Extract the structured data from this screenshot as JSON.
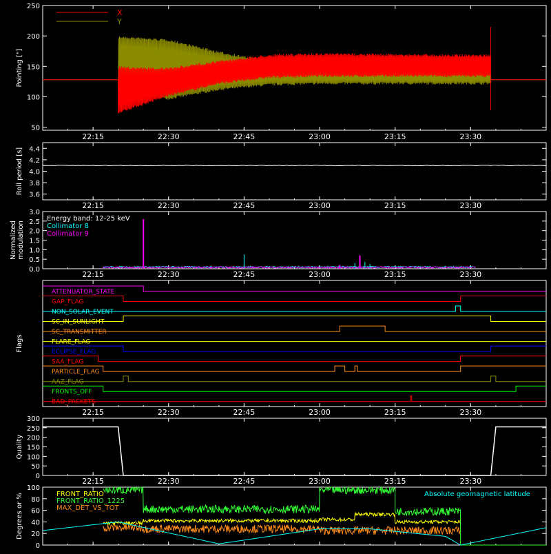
{
  "time_ticks": [
    "22:15",
    "22:30",
    "22:45",
    "23:00",
    "23:15",
    "23:30"
  ],
  "time_range": [
    "22:05",
    "23:45"
  ],
  "colors": {
    "background": "#000000",
    "axes": "#ffffff",
    "red": "#ff0000",
    "olive": "#8b8b00",
    "cyan": "#00ffff",
    "magenta": "#ff00ff",
    "yellow": "#ffff00",
    "orange": "#ff8c1a",
    "green": "#00ff00",
    "blue": "#0000ff",
    "bright_green": "#33ff33"
  },
  "chart_data": [
    {
      "type": "line",
      "ylabel": "Pointing [\"]",
      "ylim": [
        45,
        250
      ],
      "yticks": [
        50,
        100,
        150,
        200,
        250
      ],
      "legend": [
        {
          "name": "X",
          "color": "#ff0000"
        },
        {
          "name": "Y",
          "color": "#8b8b00"
        }
      ],
      "series": [
        {
          "name": "X",
          "flat_value": 128,
          "oscillation_start": "22:20",
          "oscillation_end": "23:34",
          "envelope_low": [
            [
              "22:20",
              72
            ],
            [
              "22:30",
              100
            ],
            [
              "22:40",
              120
            ],
            [
              "22:50",
              130
            ],
            [
              "23:00",
              132
            ],
            [
              "23:30",
              132
            ]
          ],
          "envelope_high": [
            [
              "22:20",
              150
            ],
            [
              "22:30",
              148
            ],
            [
              "22:40",
              160
            ],
            [
              "22:50",
              170
            ],
            [
              "23:00",
              172
            ],
            [
              "23:30",
              170
            ]
          ]
        },
        {
          "name": "Y",
          "flat_value": 128,
          "oscillation_start": "22:20",
          "oscillation_end": "23:34",
          "envelope_low": [
            [
              "22:20",
              110
            ],
            [
              "22:30",
              95
            ],
            [
              "22:40",
              110
            ],
            [
              "22:50",
              118
            ],
            [
              "23:00",
              120
            ],
            [
              "23:30",
              120
            ]
          ],
          "envelope_high": [
            [
              "22:20",
              200
            ],
            [
              "22:30",
              195
            ],
            [
              "22:40",
              175
            ],
            [
              "22:50",
              160
            ],
            [
              "23:00",
              158
            ],
            [
              "23:30",
              155
            ]
          ]
        }
      ]
    },
    {
      "type": "line",
      "ylabel": "Roll period [s]",
      "ylim": [
        3.5,
        4.5
      ],
      "yticks": [
        3.6,
        3.8,
        4.0,
        4.2,
        4.4
      ],
      "series": [
        {
          "name": "",
          "constant": 4.1
        }
      ]
    },
    {
      "type": "line",
      "ylabel_lines": [
        "Normalized",
        "modulation"
      ],
      "ylim": [
        0,
        3.0
      ],
      "yticks": [
        0.0,
        0.5,
        1.0,
        1.5,
        2.0,
        2.5,
        3.0
      ],
      "annotations": [
        {
          "text": "Energy band: 12-25 keV",
          "color": "#ffffff"
        },
        {
          "text": "Collimator 8",
          "color": "#00ffff"
        },
        {
          "text": "Collimator 9",
          "color": "#ff00ff"
        }
      ],
      "series": [
        {
          "name": "Collimator 8",
          "baseline": 0.05,
          "range": [
            "22:17",
            "23:31"
          ],
          "spikes": [
            [
              "22:45",
              0.75
            ],
            [
              "23:07",
              0.3
            ],
            [
              "23:09",
              0.35
            ],
            [
              "23:10",
              0.25
            ]
          ]
        },
        {
          "name": "Collimator 9",
          "baseline": 0.03,
          "range": [
            "22:17",
            "23:31"
          ],
          "spikes": [
            [
              "22:25",
              2.6
            ],
            [
              "23:08",
              0.7
            ],
            [
              "23:04",
              0.2
            ]
          ]
        }
      ]
    },
    {
      "type": "step",
      "ylabel": "Flags",
      "flags": [
        {
          "name": "ATTENUATOR_STATE",
          "color": "#ff00ff",
          "steps": [
            [
              "22:05",
              1
            ],
            [
              "22:25",
              0
            ],
            [
              "23:45",
              0
            ]
          ]
        },
        {
          "name": "GAP_FLAG",
          "color": "#ff0000",
          "steps": [
            [
              "22:05",
              1
            ],
            [
              "22:21",
              0
            ],
            [
              "23:28",
              1
            ],
            [
              "23:45",
              1
            ]
          ]
        },
        {
          "name": "NON_SOLAR_EVENT",
          "color": "#00ffff",
          "steps": [
            [
              "22:05",
              0
            ],
            [
              "23:27",
              1
            ],
            [
              "23:28",
              0
            ],
            [
              "23:45",
              0
            ]
          ]
        },
        {
          "name": "SC_IN_SUNLIGHT",
          "color": "#ffff00",
          "steps": [
            [
              "22:05",
              0
            ],
            [
              "22:21",
              1
            ],
            [
              "23:34",
              0
            ],
            [
              "23:45",
              0
            ]
          ]
        },
        {
          "name": "SC_TRANSMITTER",
          "color": "#ff8c1a",
          "steps": [
            [
              "22:05",
              0
            ],
            [
              "23:04",
              1
            ],
            [
              "23:13",
              0
            ],
            [
              "23:45",
              0
            ]
          ]
        },
        {
          "name": "FLARE_FLAG",
          "color": "#ffff00",
          "steps": [
            [
              "22:05",
              0
            ],
            [
              "23:45",
              0
            ]
          ]
        },
        {
          "name": "ECLIPSE_FLAG",
          "color": "#0000ff",
          "steps": [
            [
              "22:05",
              1
            ],
            [
              "22:21",
              0
            ],
            [
              "23:34",
              1
            ],
            [
              "23:45",
              1
            ]
          ]
        },
        {
          "name": "SAA_FLAG",
          "color": "#ff0000",
          "steps": [
            [
              "22:05",
              1
            ],
            [
              "22:16",
              0
            ],
            [
              "23:28",
              1
            ],
            [
              "23:45",
              1
            ]
          ]
        },
        {
          "name": "PARTICLE_FLAG",
          "color": "#ff8c1a",
          "steps": [
            [
              "22:05",
              1
            ],
            [
              "22:17",
              0
            ],
            [
              "23:03",
              1
            ],
            [
              "23:05",
              0
            ],
            [
              "23:07",
              1
            ],
            [
              "23:07.5",
              0
            ],
            [
              "23:28",
              1
            ],
            [
              "23:45",
              1
            ]
          ]
        },
        {
          "name": "AAZ_FLAG",
          "color": "#8b8b00",
          "steps": [
            [
              "22:05",
              0
            ],
            [
              "22:21",
              1
            ],
            [
              "22:22",
              0
            ],
            [
              "23:34",
              1
            ],
            [
              "23:35",
              0
            ],
            [
              "23:45",
              0
            ]
          ]
        },
        {
          "name": "FRONTS_OFF",
          "color": "#00ff00",
          "steps": [
            [
              "22:05",
              1
            ],
            [
              "22:17",
              0
            ],
            [
              "23:39",
              1
            ],
            [
              "23:45",
              1
            ]
          ]
        },
        {
          "name": "BAD_PACKETS",
          "color": "#ff0000",
          "steps": [
            [
              "22:05",
              0
            ],
            [
              "23:18",
              1
            ],
            [
              "23:18.3",
              0
            ],
            [
              "23:45",
              0
            ]
          ]
        }
      ]
    },
    {
      "type": "line",
      "ylabel": "Quality",
      "ylim": [
        0,
        300
      ],
      "yticks": [
        0,
        50,
        100,
        150,
        200,
        250,
        300
      ],
      "series": [
        {
          "name": "",
          "steps": [
            [
              "22:05",
              255
            ],
            [
              "22:20",
              255
            ],
            [
              "22:21",
              0
            ],
            [
              "23:34",
              0
            ],
            [
              "23:35",
              255
            ],
            [
              "23:45",
              255
            ]
          ]
        }
      ]
    },
    {
      "type": "line",
      "ylabel": "Degrees or %",
      "ylim": [
        0,
        100
      ],
      "yticks": [
        0,
        20,
        40,
        60,
        80,
        100
      ],
      "legend": [
        {
          "name": "FRONT_RATIO",
          "color": "#ffff00"
        },
        {
          "name": "FRONT_RATIO_1225",
          "color": "#33ff33"
        },
        {
          "name": "MAX_DET_VS_TOT",
          "color": "#ff8c1a"
        },
        {
          "name": "Absolute geomagnetic latitude",
          "color": "#00ffff"
        }
      ],
      "series": [
        {
          "name": "Absolute geomagnetic latitude",
          "points": [
            [
              "22:05",
              25
            ],
            [
              "22:20",
              40
            ],
            [
              "22:40",
              2
            ],
            [
              "23:00",
              28
            ],
            [
              "23:10",
              28
            ],
            [
              "23:25",
              15
            ],
            [
              "23:28",
              0
            ],
            [
              "23:45",
              30
            ]
          ]
        },
        {
          "name": "FRONT_RATIO_1225",
          "segments": [
            [
              "22:17",
              "22:25",
              95
            ],
            [
              "22:25",
              "23:00",
              62
            ],
            [
              "23:00",
              "23:15",
              95
            ],
            [
              "23:15",
              "23:28",
              58
            ],
            [
              "23:28",
              "23:45",
              0
            ]
          ]
        },
        {
          "name": "FRONT_RATIO",
          "segments": [
            [
              "22:17",
              "22:25",
              38
            ],
            [
              "22:25",
              "23:00",
              42
            ],
            [
              "23:00",
              "23:07",
              44
            ],
            [
              "23:07",
              "23:15",
              53
            ],
            [
              "23:15",
              "23:28",
              40
            ]
          ]
        },
        {
          "name": "MAX_DET_VS_TOT",
          "segments": [
            [
              "22:17",
              "22:25",
              30
            ],
            [
              "22:25",
              "23:00",
              28
            ],
            [
              "23:00",
              "23:28",
              25
            ]
          ]
        }
      ]
    }
  ]
}
